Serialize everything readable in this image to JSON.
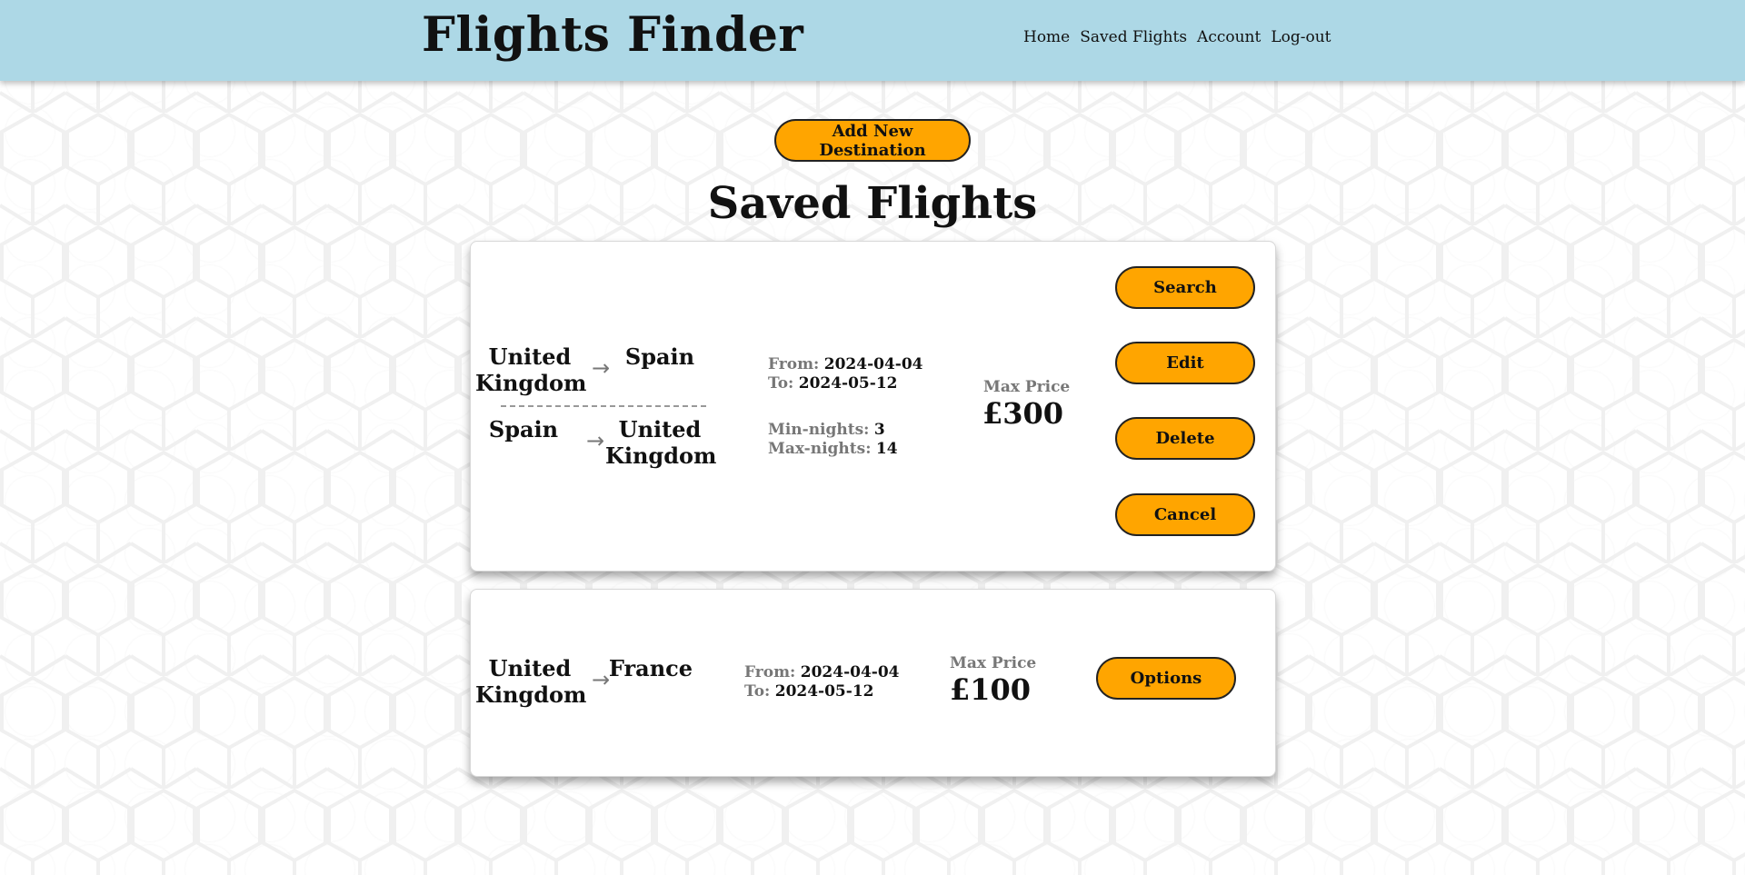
{
  "header": {
    "brand": "Flights Finder",
    "nav": [
      "Home",
      "Saved Flights",
      "Account",
      "Log-out"
    ]
  },
  "add_button": "Add New Destination",
  "page_title": "Saved Flights",
  "cards": [
    {
      "outbound": {
        "from": "United Kingdom",
        "to": "Spain"
      },
      "return": {
        "from": "Spain",
        "to": "United Kingdom"
      },
      "from_label": "From:",
      "from_date": "2024-04-04",
      "to_label": "To:",
      "to_date": "2024-05-12",
      "min_nights_label": "Min-nights:",
      "min_nights": "3",
      "max_nights_label": "Max-nights:",
      "max_nights": "14",
      "max_price_label": "Max Price",
      "max_price": "£300",
      "buttons": [
        "Search",
        "Edit",
        "Delete",
        "Cancel"
      ]
    },
    {
      "outbound": {
        "from": "United Kingdom",
        "to": "France"
      },
      "from_label": "From:",
      "from_date": "2024-04-04",
      "to_label": "To:",
      "to_date": "2024-05-12",
      "max_price_label": "Max Price",
      "max_price": "£100",
      "buttons": [
        "Options"
      ]
    }
  ],
  "icons": {
    "arrow": "arrow-right-icon"
  },
  "colors": {
    "header_bg": "#add8e6",
    "accent": "#ffa500"
  }
}
